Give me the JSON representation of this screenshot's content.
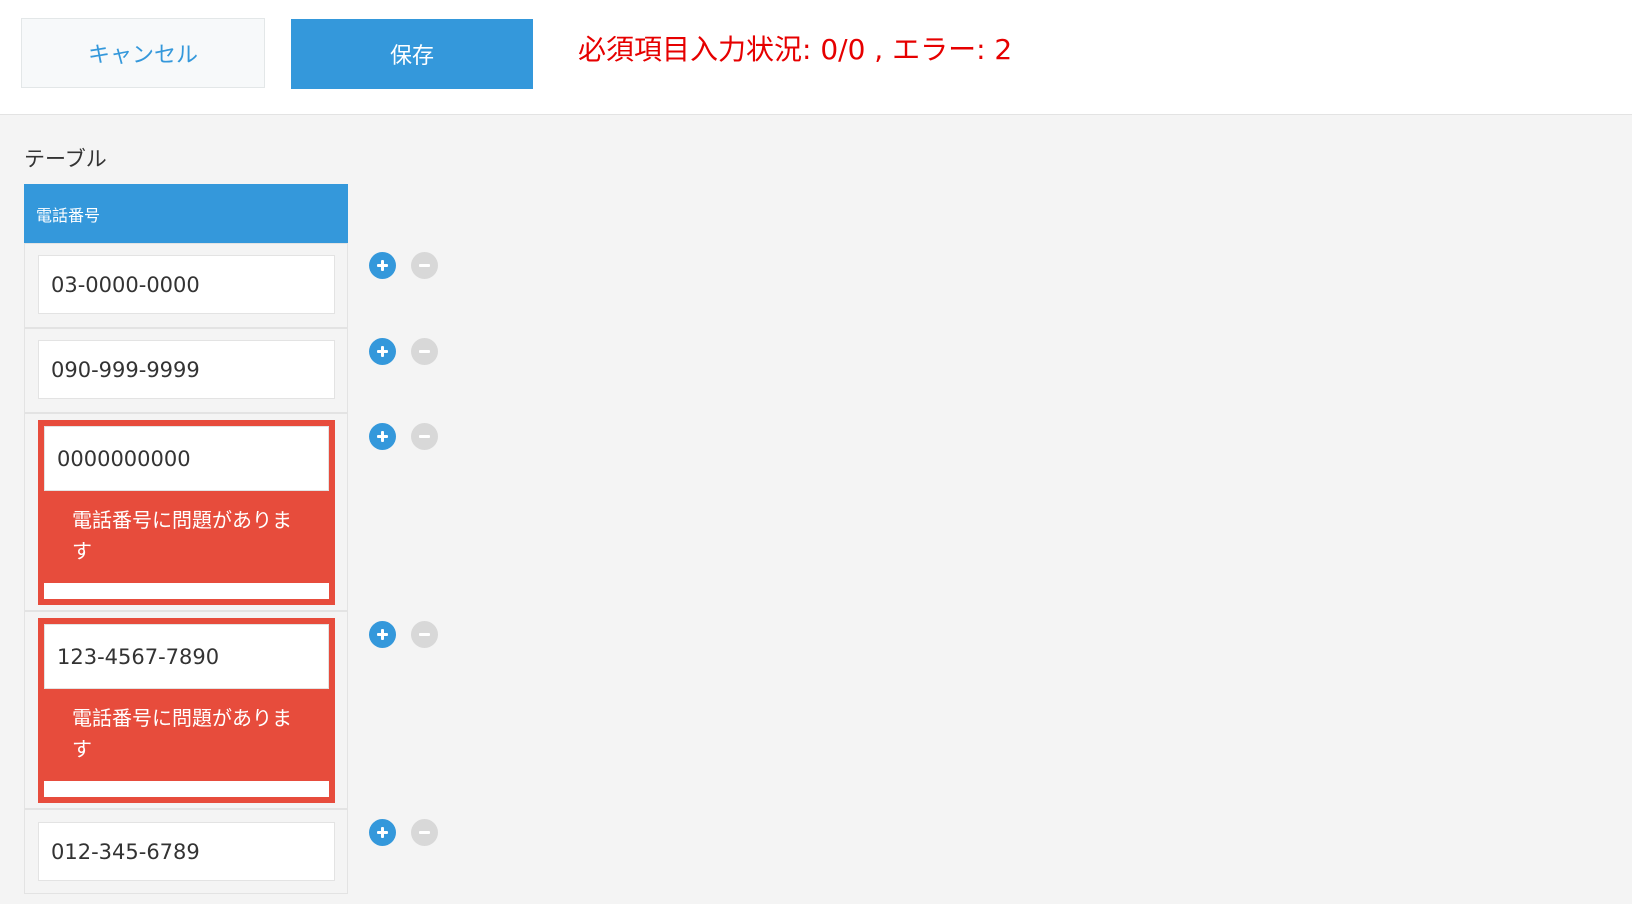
{
  "toolbar": {
    "cancel_label": "キャンセル",
    "save_label": "保存",
    "status_text": "必須項目入力状況: 0/0 , エラー: 2"
  },
  "table": {
    "label": "テーブル",
    "column_header": "電話番号",
    "rows": [
      {
        "value": "03-0000-0000",
        "error": null
      },
      {
        "value": "090-999-9999",
        "error": null
      },
      {
        "value": "0000000000",
        "error": "電話番号に問題があります"
      },
      {
        "value": "123-4567-7890",
        "error": "電話番号に問題があります"
      },
      {
        "value": "012-345-6789",
        "error": null
      }
    ]
  },
  "icons": {
    "add": "plus-circle-icon",
    "remove": "minus-circle-icon"
  },
  "colors": {
    "accent": "#3498db",
    "error": "#e74c3c",
    "status_text": "#e60000",
    "disabled": "#d8d8d8"
  }
}
